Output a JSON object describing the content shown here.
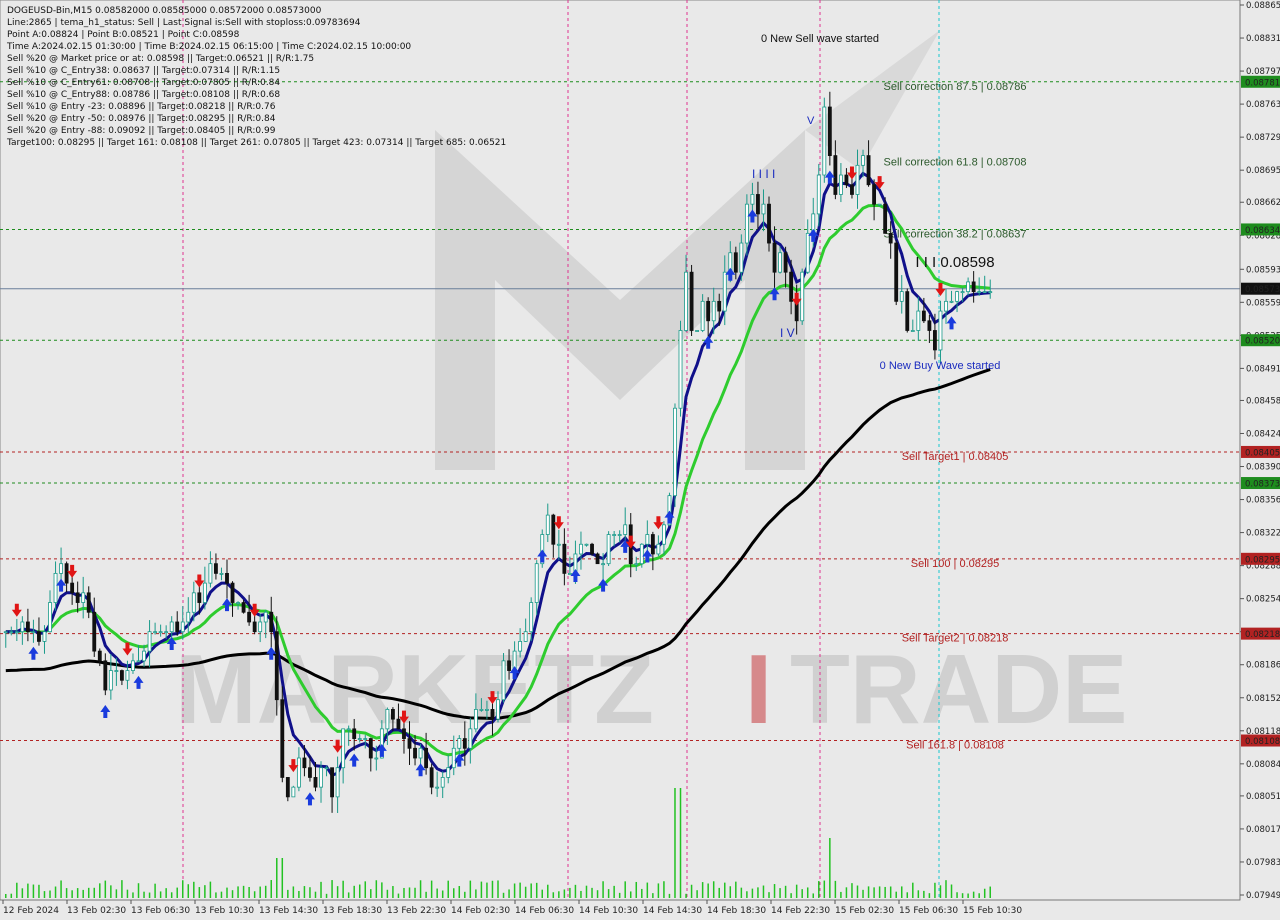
{
  "info": {
    "lines": [
      "DOGEUSD-Bin,M15  0.08582000 0.08585000 0.08572000 0.08573000",
      "Line:2865  |  tema_h1_status: Sell  |  Last Signal is:Sell with stoploss:0.09783694",
      "Point A:0.08824  |  Point B:0.08521  |  Point C:0.08598",
      "Time A:2024.02.15 01:30:00  |  Time B:2024.02.15 06:15:00  |  Time C:2024.02.15 10:00:00",
      "Sell %20 @ Market price or at: 0.08598  ||  Target:0.06521  ||  R/R:1.75",
      "Sell %10 @ C_Entry38: 0.08637  ||  Target:0.07314  ||  R/R:1.15",
      "Sell %10 @ C_Entry61: 0.08708  ||  Target:0.07805  ||  R/R:0.84",
      "Sell %10 @ C_Entry88: 0.08786  ||  Target:0.08108  ||  R/R:0.68",
      "Sell %10 @ Entry -23: 0.08896  ||  Target:0.08218  ||  R/R:0.76",
      "Sell %20 @ Entry -50: 0.08976  ||  Target:0.08295  ||  R/R:0.84",
      "Sell %20 @ Entry -88: 0.09092  ||  Target:0.08405  ||  R/R:0.99",
      "Target100: 0.08295  ||  Target 161: 0.08108  ||  Target 261: 0.07805  ||  Target 423: 0.07314  ||  Target 685: 0.06521"
    ]
  },
  "watermark": {
    "left": "MARKETZ",
    "mid": "I",
    "right": "TRADE"
  },
  "colors": {
    "bull": "#1a9a8a",
    "bear": "#111111",
    "ma_fast": "#10108a",
    "ma_mid": "#2ecc2e",
    "ma_slow": "#000000",
    "green_level": "#1e8c1e",
    "red_level": "#b22222",
    "session": "#e0338f",
    "cyan": "#19c7cf",
    "price_line": "#6a7f9a"
  },
  "chart_data": {
    "type": "candlestick",
    "symbol": "DOGEUSD-Bin",
    "timeframe": "M15",
    "ylim": [
      0.07949,
      0.08865
    ],
    "y_ticks": [
      "0.08865",
      "0.08831",
      "0.08797",
      "0.08763",
      "0.08729",
      "0.08695",
      "0.08662",
      "0.08628",
      "0.08593",
      "0.08559",
      "0.08525",
      "0.08491",
      "0.08458",
      "0.08424",
      "0.08390",
      "0.08356",
      "0.08322",
      "0.08288",
      "0.08254",
      "0.08220",
      "0.08186",
      "0.08152",
      "0.08118",
      "0.08084",
      "0.08051",
      "0.08017",
      "0.07983",
      "0.07949"
    ],
    "x_labels": [
      "12 Feb 2024",
      "13 Feb 02:30",
      "13 Feb 06:30",
      "13 Feb 10:30",
      "13 Feb 14:30",
      "13 Feb 18:30",
      "13 Feb 22:30",
      "14 Feb 02:30",
      "14 Feb 06:30",
      "14 Feb 10:30",
      "14 Feb 14:30",
      "14 Feb 18:30",
      "14 Feb 22:30",
      "15 Feb 02:30",
      "15 Feb 06:30",
      "15 Feb 10:30"
    ],
    "levels": [
      {
        "label": "Sell correction 87.5 | 0.08786",
        "price": 0.08786,
        "tag": "0.08781",
        "color": "green"
      },
      {
        "label": "Sell correction 61.8 | 0.08708",
        "price": 0.08708,
        "tag": "",
        "color": "none"
      },
      {
        "label": "Sell correction 38.2 | 0.08637",
        "price": 0.08634,
        "tag": "0.08634",
        "color": "green"
      },
      {
        "label": "",
        "price": 0.0852,
        "tag": "0.08520",
        "color": "green"
      },
      {
        "label": "Sell Target1 | 0.08405",
        "price": 0.08405,
        "tag": "0.08405",
        "color": "red"
      },
      {
        "label": "",
        "price": 0.08373,
        "tag": "0.08373",
        "color": "green"
      },
      {
        "label": "Sell 100 | 0.08295",
        "price": 0.08295,
        "tag": "0.08295",
        "color": "red"
      },
      {
        "label": "Sell Target2 | 0.08218",
        "price": 0.08218,
        "tag": "0.08218",
        "color": "red"
      },
      {
        "label": "Sell 161.8 | 0.08108",
        "price": 0.08108,
        "tag": "0.08108",
        "color": "red"
      }
    ],
    "current_price": {
      "price": 0.08573,
      "tag": "0.08573"
    },
    "point_c_label": "I I I 0.08598",
    "annotations": {
      "sell_wave": "0 New Sell wave started",
      "buy_wave": "0 New Buy Wave started",
      "wave_marks": [
        "I I I I",
        "I V",
        "V"
      ]
    },
    "series": [
      {
        "name": "close",
        "values": [
          0.0822,
          0.0822,
          0.0822,
          0.0823,
          0.0822,
          0.0822,
          0.0821,
          0.0822,
          0.0825,
          0.0828,
          0.0829,
          0.0827,
          0.0826,
          0.0825,
          0.0826,
          0.0824,
          0.082,
          0.0819,
          0.0816,
          0.0818,
          0.0818,
          0.0817,
          0.0818,
          0.0819,
          0.0819,
          0.082,
          0.0822,
          0.0822,
          0.0822,
          0.0822,
          0.0823,
          0.0822,
          0.0823,
          0.0824,
          0.0826,
          0.0825,
          0.0827,
          0.0829,
          0.0828,
          0.0828,
          0.0827,
          0.0825,
          0.0825,
          0.0824,
          0.0823,
          0.0822,
          0.0823,
          0.0824,
          0.0822,
          0.0815,
          0.0807,
          0.0805,
          0.0806,
          0.0809,
          0.0808,
          0.0807,
          0.0806,
          0.0808,
          0.0808,
          0.0805,
          0.0808,
          0.0812,
          0.0812,
          0.0811,
          0.0811,
          0.0811,
          0.0809,
          0.0809,
          0.0812,
          0.0814,
          0.0813,
          0.0812,
          0.0811,
          0.081,
          0.0809,
          0.081,
          0.0808,
          0.0806,
          0.0806,
          0.0807,
          0.0808,
          0.081,
          0.0811,
          0.081,
          0.0812,
          0.0814,
          0.0814,
          0.0814,
          0.0813,
          0.0815,
          0.0819,
          0.0818,
          0.082,
          0.0821,
          0.0822,
          0.0825,
          0.0829,
          0.0832,
          0.0834,
          0.0831,
          0.0831,
          0.0828,
          0.0828,
          0.083,
          0.0831,
          0.0831,
          0.083,
          0.0829,
          0.0829,
          0.0832,
          0.0832,
          0.0832,
          0.0833,
          0.0829,
          0.0829,
          0.0831,
          0.0832,
          0.083,
          0.0831,
          0.0833,
          0.0836,
          0.0845,
          0.0853,
          0.0859,
          0.0853,
          0.0853,
          0.0856,
          0.0854,
          0.0856,
          0.0855,
          0.0859,
          0.0861,
          0.0859,
          0.0862,
          0.0866,
          0.0867,
          0.0865,
          0.0866,
          0.0862,
          0.0859,
          0.0861,
          0.0859,
          0.0856,
          0.0854,
          0.0859,
          0.0863,
          0.0865,
          0.0869,
          0.0876,
          0.0871,
          0.0867,
          0.0869,
          0.0868,
          0.0867,
          0.087,
          0.0871,
          0.0868,
          0.0866,
          0.0866,
          0.0863,
          0.0862,
          0.0856,
          0.0857,
          0.0853,
          0.0853,
          0.0855,
          0.0854,
          0.0853,
          0.0851,
          0.0855,
          0.0856,
          0.0856,
          0.0857,
          0.0857,
          0.0858,
          0.0857,
          0.0857,
          0.0857,
          0.0857
        ]
      }
    ]
  }
}
